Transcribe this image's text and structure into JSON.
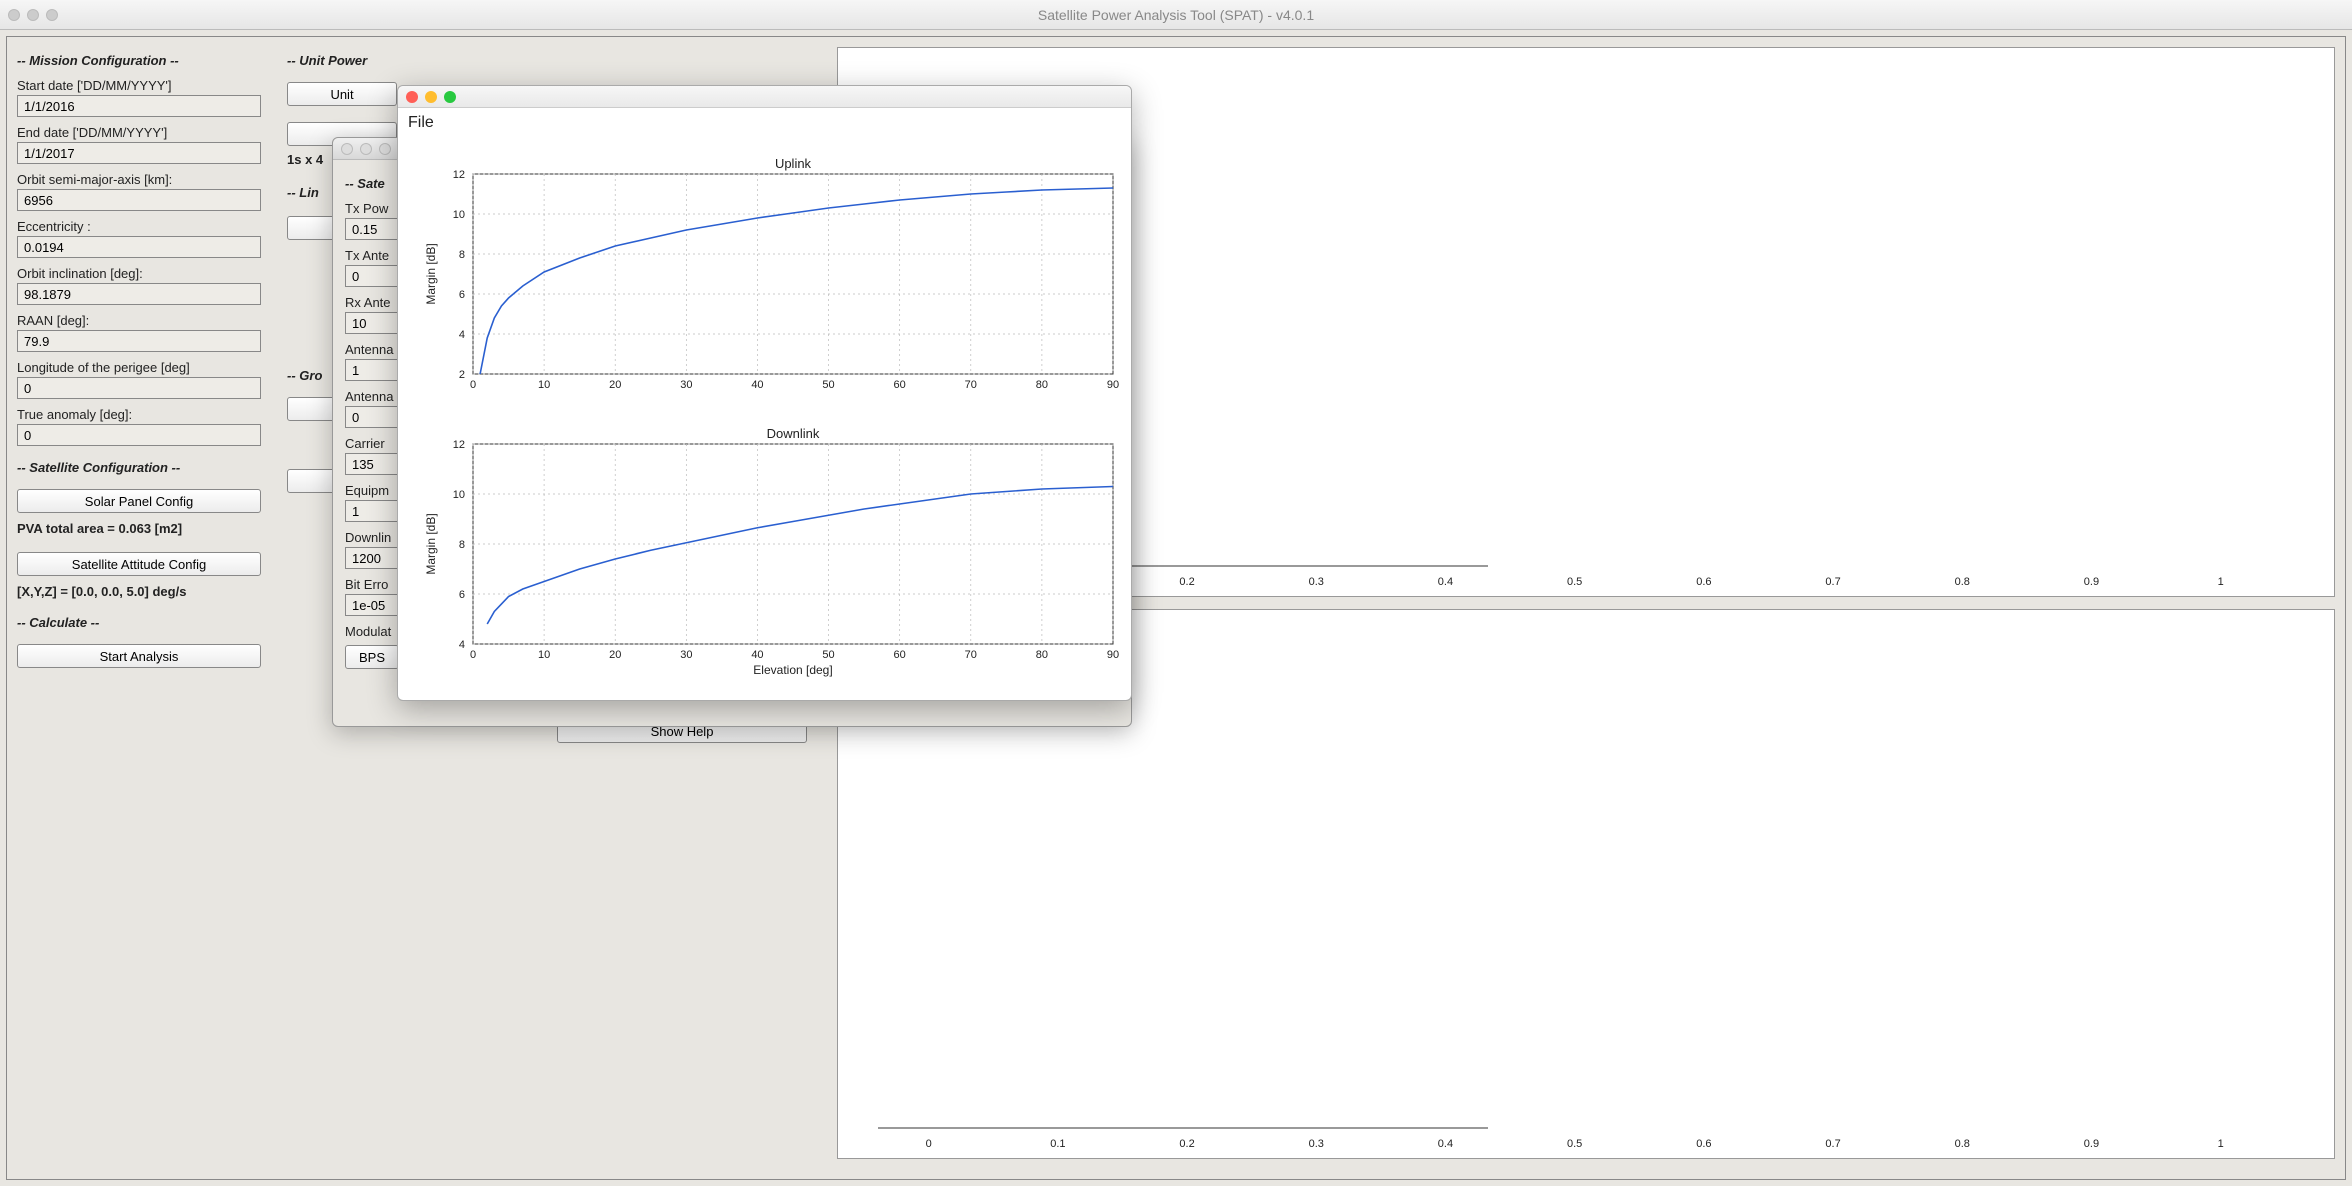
{
  "window": {
    "title": "Satellite Power Analysis Tool (SPAT) - v4.0.1"
  },
  "mission": {
    "heading": "-- Mission Configuration --",
    "start_label": "Start date ['DD/MM/YYYY']",
    "start_value": "1/1/2016",
    "end_label": "End date ['DD/MM/YYYY']",
    "end_value": "1/1/2017",
    "sma_label": "Orbit semi-major-axis [km]:",
    "sma_value": "6956",
    "ecc_label": "Eccentricity :",
    "ecc_value": "0.0194",
    "inc_label": "Orbit inclination [deg]:",
    "inc_value": "98.1879",
    "raan_label": "RAAN [deg]:",
    "raan_value": "79.9",
    "lonp_label": "Longitude of the perigee [deg]",
    "lonp_value": "0",
    "ta_label": "True anomaly [deg]:",
    "ta_value": "0"
  },
  "satcfg": {
    "heading": "-- Satellite Configuration --",
    "solar_btn": "Solar Panel Config",
    "pva_text": "PVA total area = 0.063 [m2]",
    "att_btn": "Satellite Attitude Config",
    "xyz_text": "[X,Y,Z] = [0.0, 0.0, 5.0] deg/s"
  },
  "calc": {
    "heading": "-- Calculate --",
    "start_btn": "Start Analysis"
  },
  "mid": {
    "unit_heading": "-- Unit Power",
    "unit_btn": "Unit",
    "sim_info": "1s x 4",
    "link_heading": "-- Lin",
    "ground_heading": "-- Gro",
    "show_help_btn": "Show Help"
  },
  "midcol": {
    "heading": "-- Sate",
    "txpow_label": "Tx Pow",
    "txpow_value": "0.15",
    "txant_label": "Tx Ante",
    "txant_value": "0",
    "rxant_label": "Rx Ante",
    "rxant_value": "10",
    "ant1_label": "Antenna",
    "ant1_value": "1",
    "ant2_label": "Antenna",
    "ant2_value": "0",
    "carrier_label": "Carrier",
    "carrier_value": "135",
    "equip_label": "Equipm",
    "equip_value": "1",
    "down_label": "Downlin",
    "down_value": "1200",
    "ber_label": "Bit Erro",
    "ber_value": "1e-05",
    "mod_label": "Modulat",
    "mod_value": "BPS"
  },
  "popup": {
    "file_menu": "File"
  },
  "chart_data": [
    {
      "type": "line",
      "title": "Uplink",
      "xlabel": "",
      "ylabel": "Margin [dB]",
      "xlim": [
        0,
        90
      ],
      "ylim": [
        2,
        12
      ],
      "xticks": [
        0,
        10,
        20,
        30,
        40,
        50,
        60,
        70,
        80,
        90
      ],
      "yticks": [
        2,
        4,
        6,
        8,
        10,
        12
      ],
      "series": [
        {
          "name": "uplink",
          "x": [
            1,
            2,
            3,
            4,
            5,
            7,
            10,
            15,
            20,
            25,
            30,
            35,
            40,
            45,
            50,
            55,
            60,
            65,
            70,
            75,
            80,
            85,
            90
          ],
          "y": [
            2.0,
            3.8,
            4.8,
            5.4,
            5.8,
            6.4,
            7.1,
            7.8,
            8.4,
            8.8,
            9.2,
            9.5,
            9.8,
            10.05,
            10.3,
            10.5,
            10.7,
            10.85,
            11.0,
            11.1,
            11.2,
            11.25,
            11.3
          ]
        }
      ]
    },
    {
      "type": "line",
      "title": "Downlink",
      "xlabel": "Elevation [deg]",
      "ylabel": "Margin [dB]",
      "xlim": [
        0,
        90
      ],
      "ylim": [
        4,
        12
      ],
      "xticks": [
        0,
        10,
        20,
        30,
        40,
        50,
        60,
        70,
        80,
        90
      ],
      "yticks": [
        4,
        6,
        8,
        10,
        12
      ],
      "series": [
        {
          "name": "downlink",
          "x": [
            2,
            3,
            5,
            7,
            10,
            15,
            20,
            25,
            30,
            35,
            40,
            45,
            50,
            55,
            60,
            65,
            70,
            75,
            80,
            85,
            90
          ],
          "y": [
            4.8,
            5.3,
            5.9,
            6.2,
            6.5,
            7.0,
            7.4,
            7.75,
            8.05,
            8.35,
            8.65,
            8.9,
            9.15,
            9.4,
            9.6,
            9.8,
            10.0,
            10.1,
            10.2,
            10.25,
            10.3
          ]
        }
      ]
    }
  ],
  "right_axis": {
    "ticks": [
      "0",
      "0.1",
      "0.2",
      "0.3",
      "0.4",
      "0.5",
      "0.6",
      "0.7",
      "0.8",
      "0.9",
      "1"
    ]
  }
}
